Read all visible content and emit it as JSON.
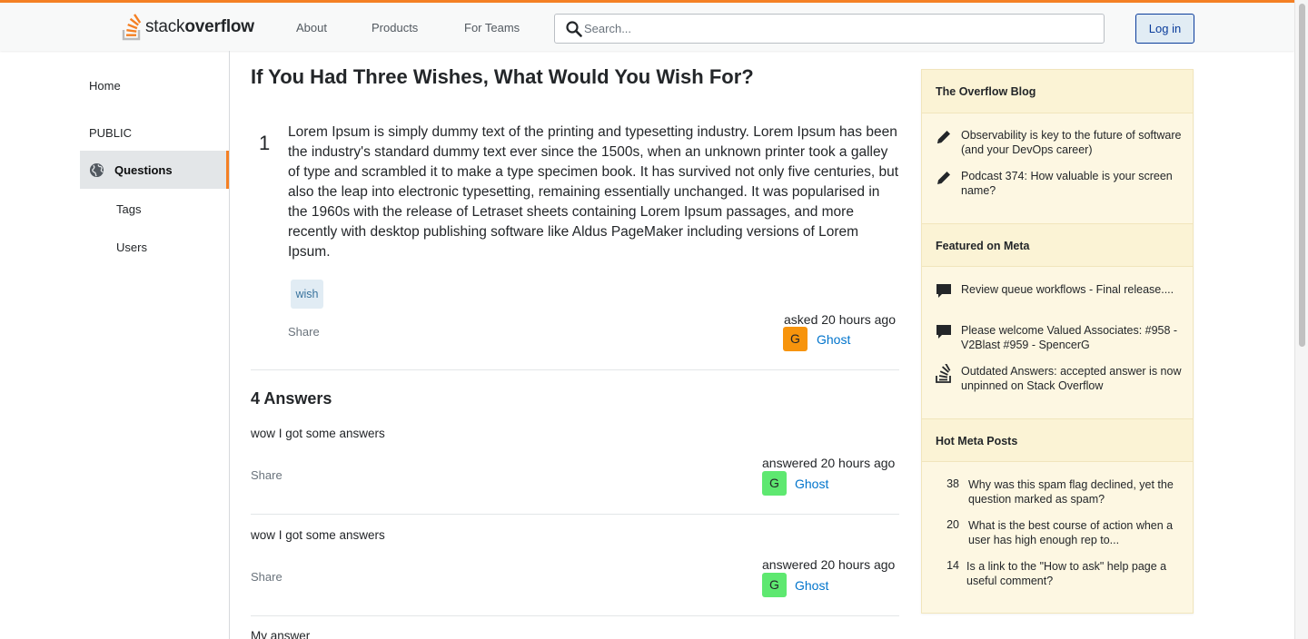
{
  "header": {
    "logo_light": "stack",
    "logo_bold": "overflow",
    "nav": [
      "About",
      "Products",
      "For Teams"
    ],
    "search_placeholder": "Search...",
    "login_label": "Log in",
    "accent_color": "#f48024"
  },
  "sidebar": {
    "home": "Home",
    "section": "PUBLIC",
    "questions": "Questions",
    "tags": "Tags",
    "users": "Users"
  },
  "question": {
    "title": "If You Had Three Wishes, What Would You Wish For?",
    "votes": "1",
    "body": "Lorem Ipsum is simply dummy text of the printing and typesetting industry. Lorem Ipsum has been the industry's standard dummy text ever since the 1500s, when an unknown printer took a galley of type and scrambled it to make a type specimen book. It has survived not only five centuries, but also the leap into electronic typesetting, remaining essentially unchanged. It was popularised in the 1960s with the release of Letraset sheets containing Lorem Ipsum passages, and more recently with desktop publishing software like Aldus PageMaker including versions of Lorem Ipsum.",
    "tag": "wish",
    "share": "Share",
    "asked": "asked 20 hours ago",
    "avatar_letter": "G",
    "avatar_color": "#f7940c",
    "user": "Ghost"
  },
  "answers": {
    "heading": "4 Answers",
    "items": [
      {
        "text": "wow I got some answers",
        "share": "Share",
        "time": "answered 20 hours ago",
        "avatar_letter": "G",
        "avatar_color": "#5ee870",
        "user": "Ghost"
      },
      {
        "text": "wow I got some answers",
        "share": "Share",
        "time": "answered 20 hours ago",
        "avatar_letter": "G",
        "avatar_color": "#5ee870",
        "user": "Ghost"
      },
      {
        "text": "My answer"
      }
    ]
  },
  "widget": {
    "blog_title": "The Overflow Blog",
    "blog_items": [
      {
        "icon": "pencil-icon",
        "text": "Observability is key to the future of software (and your DevOps career)"
      },
      {
        "icon": "pencil-icon",
        "text": "Podcast 374: How valuable is your screen name?"
      }
    ],
    "meta_title": "Featured on Meta",
    "meta_items": [
      {
        "icon": "speech-bubble-icon",
        "text": "Review queue workflows - Final release...."
      },
      {
        "icon": "speech-bubble-icon",
        "text": "Please welcome Valued Associates: #958 - V2Blast #959 - SpencerG"
      },
      {
        "icon": "stackoverflow-icon",
        "text": "Outdated Answers: accepted answer is now unpinned on Stack Overflow"
      }
    ],
    "hot_title": "Hot Meta Posts",
    "hot_items": [
      {
        "count": "38",
        "text": "Why was this spam flag declined, yet the question marked as spam?"
      },
      {
        "count": "20",
        "text": "What is the best course of action when a user has high enough rep to..."
      },
      {
        "count": "14",
        "text": "Is a link to the \"How to ask\" help page a useful comment?"
      }
    ]
  }
}
